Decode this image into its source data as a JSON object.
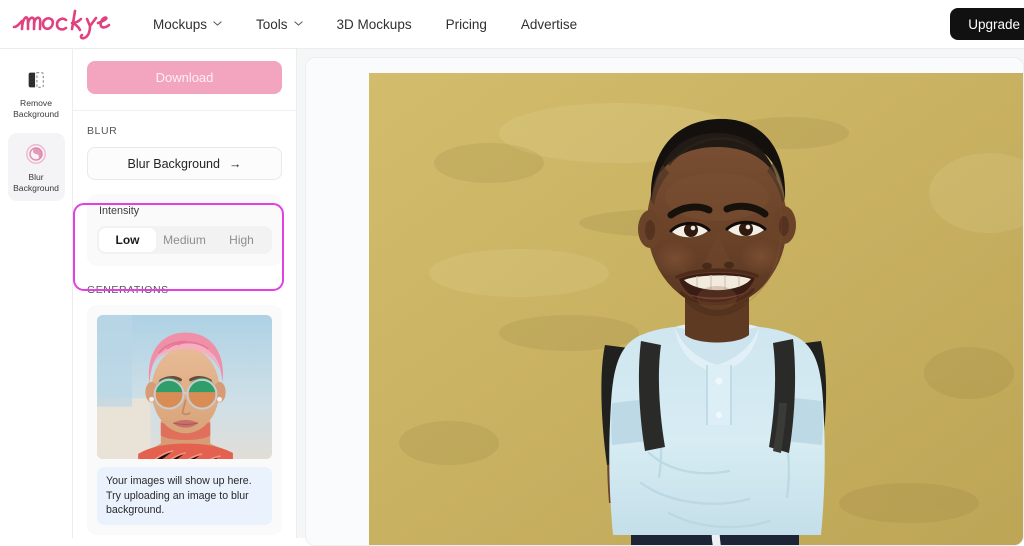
{
  "nav": {
    "logo_text": "mockey",
    "items": [
      {
        "label": "Mockups",
        "has_caret": true
      },
      {
        "label": "Tools",
        "has_caret": true
      },
      {
        "label": "3D Mockups",
        "has_caret": false
      },
      {
        "label": "Pricing",
        "has_caret": false
      },
      {
        "label": "Advertise",
        "has_caret": false
      }
    ],
    "upgrade_label": "Upgrade"
  },
  "rail": {
    "items": [
      {
        "label_line1": "Remove",
        "label_line2": "Background",
        "icon": "remove-background-icon",
        "active": false
      },
      {
        "label_line1": "Blur",
        "label_line2": "Background",
        "icon": "blur-background-icon",
        "active": true
      }
    ]
  },
  "panel": {
    "download_label": "Download",
    "blur_section_title": "BLUR",
    "blur_button_label": "Blur Background",
    "blur_button_arrow": "→",
    "intensity_label": "Intensity",
    "intensity_options": [
      "Low",
      "Medium",
      "High"
    ],
    "intensity_selected": "Low",
    "generations_title": "GENERATIONS",
    "generations_note": "Your images will show up here. Try uploading an image to blur background.",
    "highlight_color": "#e43fe0",
    "accent_pink": "#f3a4bf"
  },
  "canvas": {
    "photo_alt": "Smiling young boy wearing light blue polo shirt and black backpack against a yellow wall",
    "background_color": "#c9b262"
  }
}
